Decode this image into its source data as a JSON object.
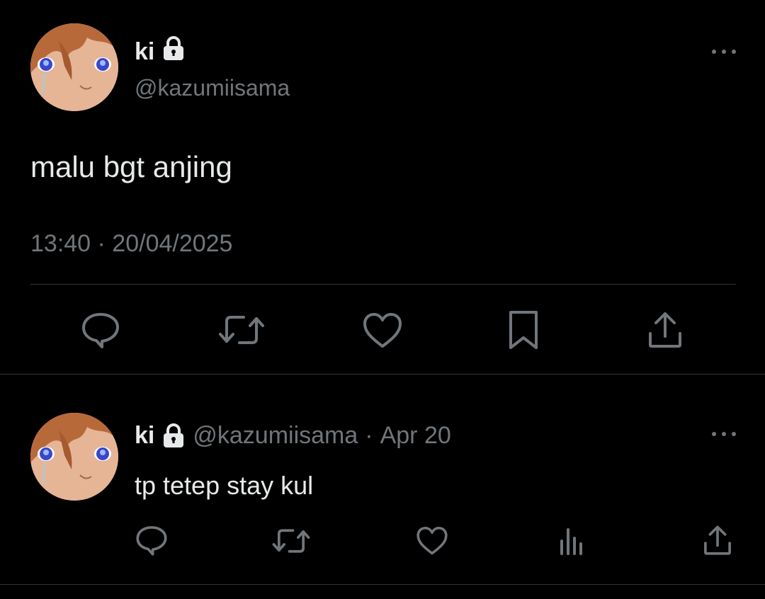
{
  "main_tweet": {
    "author_name": "ki",
    "author_handle": "@kazumiisama",
    "text": "malu bgt anjing",
    "timestamp": "13:40 · 20/04/2025",
    "actions": [
      "reply-icon",
      "retweet-icon",
      "like-icon",
      "bookmark-icon",
      "share-icon"
    ]
  },
  "reply": {
    "author_name": "ki",
    "author_handle": "@kazumiisama",
    "separator": "·",
    "date": "Apr 20",
    "text": "tp tetep stay kul",
    "actions": [
      "reply-icon",
      "retweet-icon",
      "like-icon",
      "analytics-icon",
      "share-icon"
    ]
  },
  "colors": {
    "background": "#000000",
    "primary_text": "#e7e9ea",
    "secondary_text": "#71767b",
    "divider": "#2f3336",
    "icon": "#71767b"
  }
}
